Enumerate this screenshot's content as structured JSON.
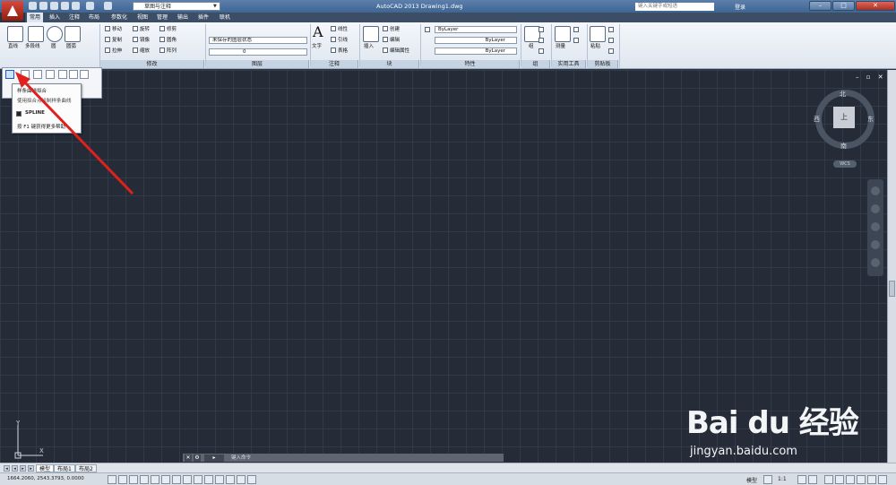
{
  "titlebar": {
    "workspace": "草图与注释",
    "app_title": "AutoCAD 2013   Drawing1.dwg",
    "search_placeholder": "键入关键字或短语",
    "login": "登录"
  },
  "tabs": [
    "常用",
    "插入",
    "注释",
    "布局",
    "参数化",
    "视图",
    "管理",
    "输出",
    "插件",
    "联机"
  ],
  "ribbon": {
    "draw": {
      "line": "直线",
      "polyline": "多段线",
      "circle": "圆",
      "arc": "圆弧"
    },
    "modify": {
      "label": "修改",
      "move": "移动",
      "rotate": "旋转",
      "trim": "修剪",
      "copy": "复制",
      "mirror": "镜像",
      "fillet": "圆角",
      "stretch": "拉伸",
      "scale": "缩放",
      "array": "阵列"
    },
    "layers": {
      "label": "图层",
      "state": "未保存的图层状态",
      "current": "0"
    },
    "annotation": {
      "label": "注释",
      "text": "文字",
      "linear": "线性",
      "leader": "引线",
      "table": "表格"
    },
    "block": {
      "label": "块",
      "insert": "插入",
      "create": "创建",
      "edit": "编辑",
      "edit_attr": "编辑属性"
    },
    "properties": {
      "label": "特性",
      "color": "ByLayer",
      "linetype": "ByLayer",
      "lineweight": "ByLayer"
    },
    "groups": {
      "label": "组",
      "group": "组"
    },
    "utilities": {
      "label": "实用工具",
      "measure": "测量"
    },
    "clipboard": {
      "label": "剪贴板",
      "paste": "粘贴"
    }
  },
  "tooltip": {
    "title": "样条曲线拟合",
    "desc": "使用拟合点绘制样条曲线",
    "command": "SPLINE",
    "help": "按 F1 键获得更多帮助"
  },
  "viewcube": {
    "north": "北",
    "south": "南",
    "east": "东",
    "west": "西",
    "top": "上",
    "wcs": "WCS"
  },
  "command": {
    "placeholder": "键入命令"
  },
  "layout_tabs": [
    "模型",
    "布局1",
    "布局2"
  ],
  "status": {
    "coords": "1664.2060, 2543.3793, 0.0000",
    "model": "模型",
    "scale": "1:1"
  },
  "ucs": {
    "x": "X",
    "y": "Y"
  },
  "watermark": {
    "brand": "Bai du 经验",
    "url": "jingyan.baidu.com"
  }
}
